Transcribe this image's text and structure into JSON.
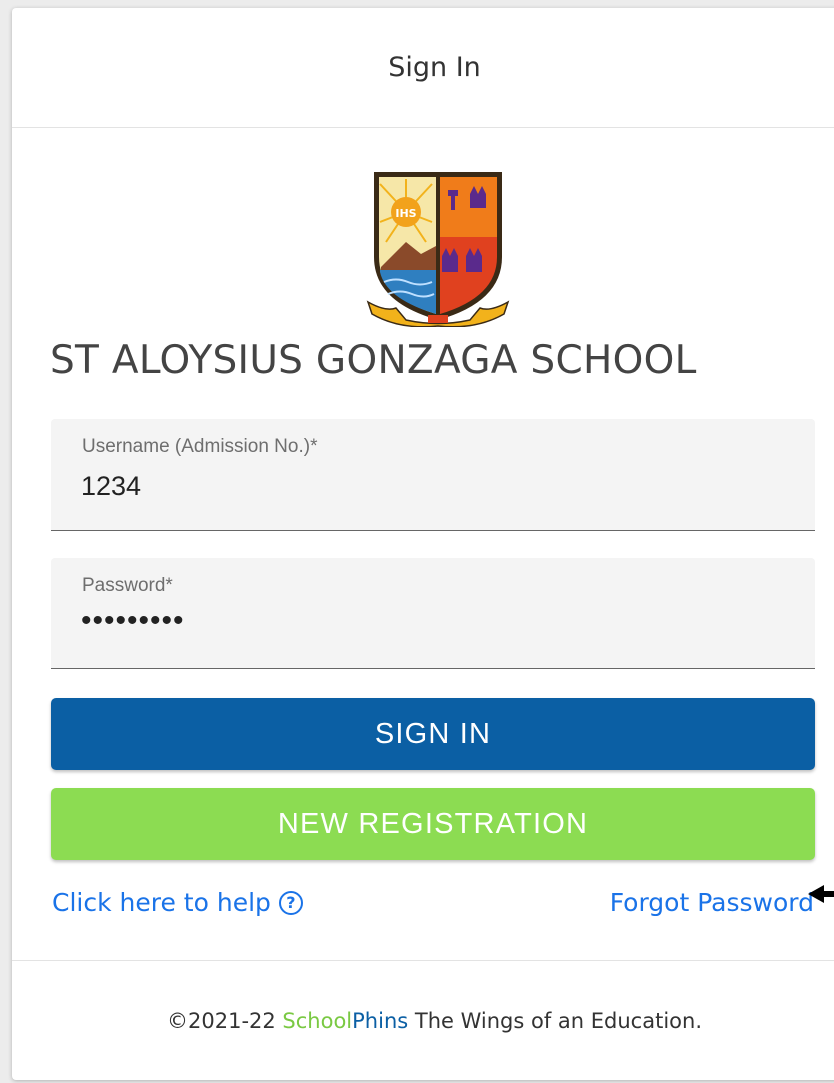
{
  "header": {
    "title": "Sign In"
  },
  "crest": {
    "monogram": "IHS",
    "colors": {
      "gold": "#f2b21b",
      "red": "#e0411f",
      "orange": "#f07c1a",
      "purple": "#5a2a8c",
      "sea": "#2f7fc0"
    }
  },
  "school": {
    "name": "ST ALOYSIUS GONZAGA SCHOOL"
  },
  "form": {
    "username": {
      "label": "Username (Admission No.)*",
      "value": "1234"
    },
    "password": {
      "label": "Password*",
      "value": "•••••••••"
    }
  },
  "buttons": {
    "sign_in": "SIGN IN",
    "new_registration": "NEW REGISTRATION"
  },
  "links": {
    "help": "Click here to help",
    "help_icon": "?",
    "forgot_password": "Forgot Password"
  },
  "footer": {
    "copyright": "©2021-22 ",
    "brand_part1": "School",
    "brand_part2": "Phins",
    "tagline": " The Wings of an Education."
  },
  "colors": {
    "primary": "#0b5fa4",
    "success": "#8cdc52",
    "link": "#1a73e8"
  }
}
